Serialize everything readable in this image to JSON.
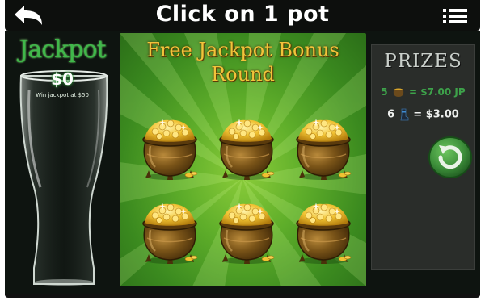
{
  "header": {
    "title": "Click on 1 pot",
    "back_icon": "back-arrow-icon",
    "menu_icon": "menu-list-icon"
  },
  "jackpot": {
    "title": "Jackpot",
    "value": "$0",
    "note": "Win jackpot at $50"
  },
  "game": {
    "title_line1": "Free Jackpot Bonus",
    "title_line2": "Round",
    "pots": [
      {
        "name": "pot-1"
      },
      {
        "name": "pot-2"
      },
      {
        "name": "pot-3"
      },
      {
        "name": "pot-4"
      },
      {
        "name": "pot-5"
      },
      {
        "name": "pot-6"
      }
    ]
  },
  "prizes": {
    "title": "PRIZES",
    "rows": [
      {
        "count": "5",
        "icon": "mini-pot-icon",
        "sep": "=",
        "amount": "$7.00 JP"
      },
      {
        "count": "6",
        "icon": "boot-icon",
        "sep": "=",
        "amount": "$3.00"
      }
    ],
    "replay_icon": "replay-icon"
  },
  "colors": {
    "topbar": "#0d0f0d",
    "board": "#0e1410",
    "jackpot_green": "#3fb84a",
    "game_green": "#5fae2a",
    "gold": "#f2c33a",
    "prize_panel": "#2a2d2a",
    "replay_green": "#3d8f3a"
  }
}
